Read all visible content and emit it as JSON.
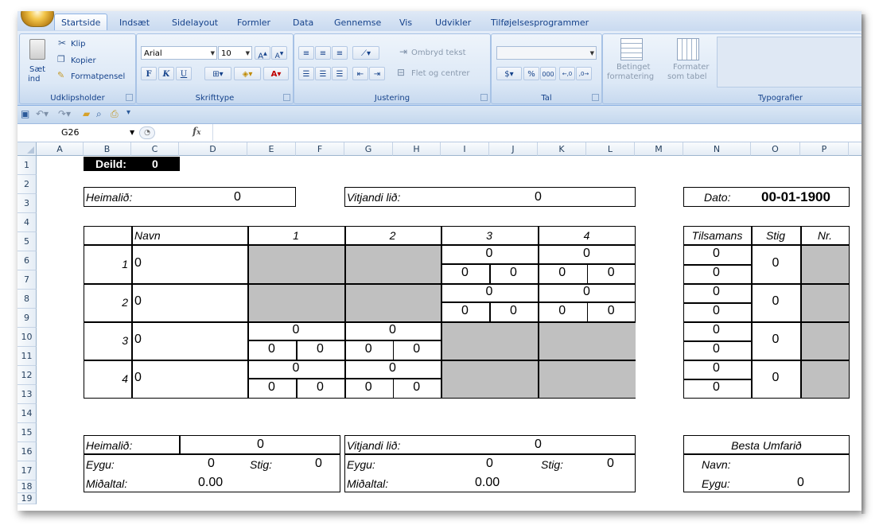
{
  "ribbon": {
    "tabs": [
      "Startside",
      "Indsæt",
      "Sidelayout",
      "Formler",
      "Data",
      "Gennemse",
      "Vis",
      "Udvikler",
      "Tilføjelsesprogrammer"
    ],
    "clipboard": {
      "paste": "Sæt ind",
      "paste_line1": "Sæt",
      "paste_line2": "ind",
      "cut": "Klip",
      "copy": "Kopier",
      "format_painter": "Formatpensel",
      "label": "Udklipsholder"
    },
    "font": {
      "name": "Arial",
      "size": "10",
      "label": "Skrifttype",
      "bold": "F",
      "italic": "K",
      "underline": "U"
    },
    "alignment": {
      "wrap": "Ombryd tekst",
      "merge": "Flet og centrer",
      "label": "Justering"
    },
    "number": {
      "format": "",
      "currency": "$",
      "percent": "%",
      "thousands": "000",
      "label": "Tal"
    },
    "styles": {
      "conditional": "Betinget formatering",
      "conditional_l1": "Betinget",
      "conditional_l2": "formatering",
      "table": "Formater som tabel",
      "table_l1": "Formater",
      "table_l2": "som tabel",
      "label": "Typografier"
    }
  },
  "formula_bar": {
    "name_box": "G26",
    "fx": "fx",
    "formula": ""
  },
  "columns": [
    "A",
    "B",
    "C",
    "D",
    "E",
    "F",
    "G",
    "H",
    "I",
    "J",
    "K",
    "L",
    "M",
    "N",
    "O",
    "P"
  ],
  "rows": [
    "1",
    "2",
    "3",
    "4",
    "5",
    "6",
    "7",
    "8",
    "9",
    "10",
    "11",
    "12",
    "13",
    "14",
    "15",
    "16",
    "17",
    "18",
    "19"
  ],
  "sheet": {
    "deild_label": "Deild:",
    "deild_value": "0",
    "home_label": "Heimalið:",
    "home_value": "0",
    "away_label": "Vitjandi lið:",
    "away_value": "0",
    "date_label": "Dato:",
    "date_value": "00-01-1900",
    "table": {
      "navn": "Navn",
      "cols": [
        "1",
        "2",
        "3",
        "4"
      ],
      "players": [
        {
          "nr": "1",
          "name": "0"
        },
        {
          "nr": "2",
          "name": "0"
        },
        {
          "nr": "3",
          "name": "0"
        },
        {
          "nr": "4",
          "name": "0"
        }
      ],
      "zero": "0"
    },
    "summary": {
      "total": "Tilsamans",
      "stig": "Stig",
      "nr": "Nr.",
      "zero": "0"
    },
    "bottom": {
      "home_label": "Heimalið:",
      "home_value": "0",
      "eygu_label": "Eygu:",
      "home_eygu": "0",
      "stig_label": "Stig:",
      "home_stig": "0",
      "avg_label": "Miðaltal:",
      "home_avg": "0.00",
      "away_label": "Vitjandi lið:",
      "away_value": "0",
      "away_eygu": "0",
      "away_stig": "0",
      "away_avg": "0.00"
    },
    "best": {
      "title": "Besta Umfarið",
      "navn_label": "Navn:",
      "navn_value": "",
      "eygu_label": "Eygu:",
      "eygu_value": "0"
    }
  }
}
